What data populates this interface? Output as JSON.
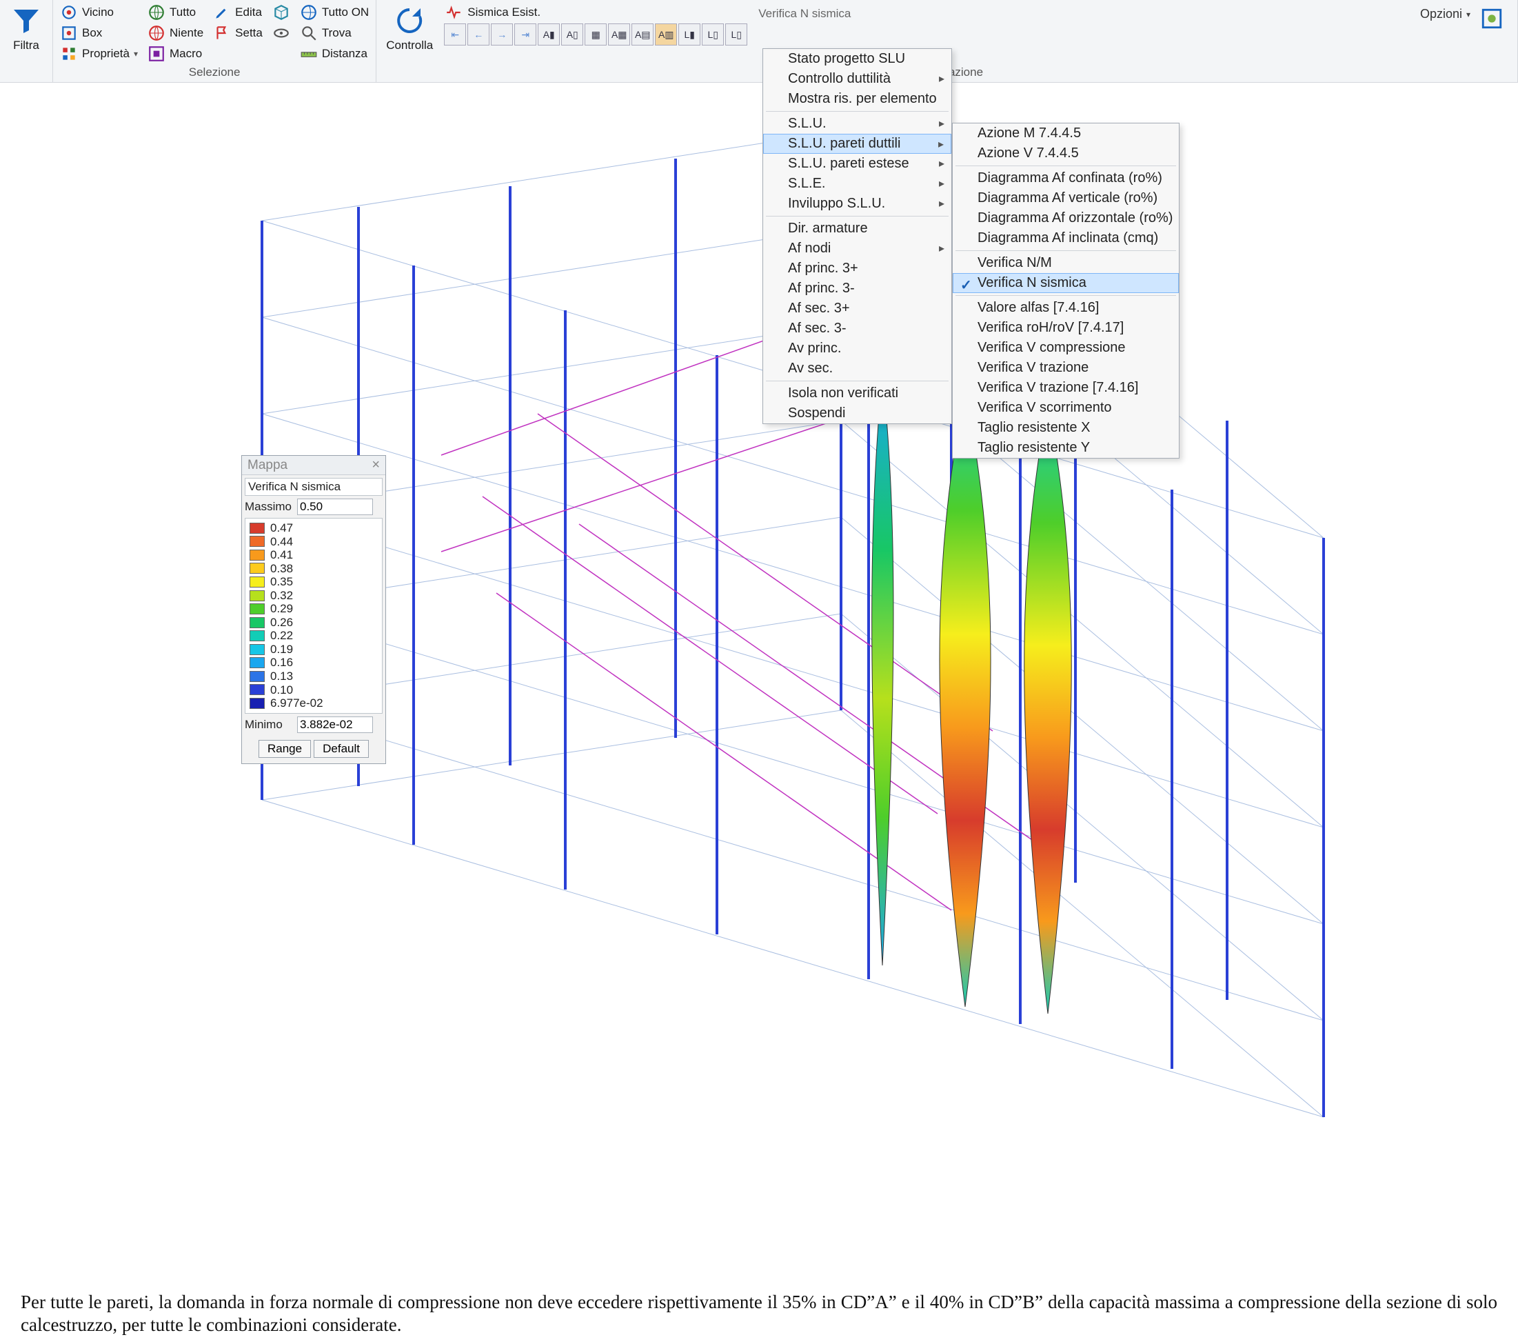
{
  "ribbon": {
    "filtra": "Filtra",
    "vicino": "Vicino",
    "box": "Box",
    "proprieta": "Proprietà",
    "tutto": "Tutto",
    "niente": "Niente",
    "edita": "Edita",
    "setta": "Setta",
    "tutto_on": "Tutto ON",
    "trova": "Trova",
    "distanza": "Distanza",
    "macro": "Macro",
    "selezione_title": "Selezione",
    "controlla": "Controlla",
    "sismica_esist": "Sismica Esist.",
    "hint_text": "Verifica N sismica",
    "progettazione_title": "Progettazione",
    "opzioni": "Opzioni"
  },
  "menu_main": {
    "stato_progetto": "Stato progetto SLU",
    "controllo_duttilita": "Controllo duttilità",
    "mostra_ris": "Mostra ris. per elemento",
    "slu": "S.L.U.",
    "slu_pareti_duttili": "S.L.U. pareti duttili",
    "slu_pareti_estese": "S.L.U. pareti estese",
    "sle": "S.L.E.",
    "inviluppo": "Inviluppo S.L.U.",
    "dir_armature": "Dir. armature",
    "af_nodi": "Af nodi",
    "af_princ_3p": "Af princ. 3+",
    "af_princ_3m": "Af princ. 3-",
    "af_sec_3p": "Af sec. 3+",
    "af_sec_3m": "Af sec. 3-",
    "av_princ": "Av princ.",
    "av_sec": "Av sec.",
    "isola": "Isola non verificati",
    "sospendi": "Sospendi"
  },
  "menu_sub": {
    "azione_m": "Azione M 7.4.4.5",
    "azione_v": "Azione V 7.4.4.5",
    "diag_af_conf": "Diagramma Af confinata (ro%)",
    "diag_af_vert": "Diagramma Af verticale (ro%)",
    "diag_af_oriz": "Diagramma Af orizzontale (ro%)",
    "diag_af_incl": "Diagramma Af inclinata (cmq)",
    "verifica_nm": "Verifica N/M",
    "verifica_n_sismica": "Verifica N sismica",
    "valore_alfas": "Valore alfas [7.4.16]",
    "verifica_roh": "Verifica roH/roV [7.4.17]",
    "verifica_v_comp": "Verifica V compressione",
    "verifica_v_traz": "Verifica V trazione",
    "verifica_v_traz_7416": "Verifica V trazione [7.4.16]",
    "verifica_v_scorr": "Verifica V scorrimento",
    "taglio_res_x": "Taglio resistente X",
    "taglio_res_y": "Taglio resistente Y"
  },
  "mappa": {
    "title": "Mappa",
    "subtitle": "Verifica N sismica",
    "massimo_label": "Massimo",
    "massimo_value": "0.50",
    "minimo_label": "Minimo",
    "minimo_value": "3.882e-02",
    "range": "Range",
    "default": "Default",
    "legend": [
      {
        "color": "#d73c2c",
        "label": "0.47"
      },
      {
        "color": "#ef6a28",
        "label": "0.44"
      },
      {
        "color": "#f89a1c",
        "label": "0.41"
      },
      {
        "color": "#fdcb1c",
        "label": "0.38"
      },
      {
        "color": "#f6ee1c",
        "label": "0.35"
      },
      {
        "color": "#b6e01c",
        "label": "0.32"
      },
      {
        "color": "#4ece2a",
        "label": "0.29"
      },
      {
        "color": "#18c765",
        "label": "0.26"
      },
      {
        "color": "#12cdb6",
        "label": "0.22"
      },
      {
        "color": "#16c6e6",
        "label": "0.19"
      },
      {
        "color": "#1aa7ef",
        "label": "0.16"
      },
      {
        "color": "#2c74e6",
        "label": "0.13"
      },
      {
        "color": "#2a40d6",
        "label": "0.10"
      },
      {
        "color": "#1820b2",
        "label": "6.977e-02"
      }
    ]
  },
  "caption": "Per tutte le pareti, la domanda in forza normale di compressione non deve eccedere rispettivamente il 35% in CD”A” e il 40% in CD”B” della capacità massima a compressione della sezione di solo calcestruzzo, per tutte le combinazioni considerate."
}
